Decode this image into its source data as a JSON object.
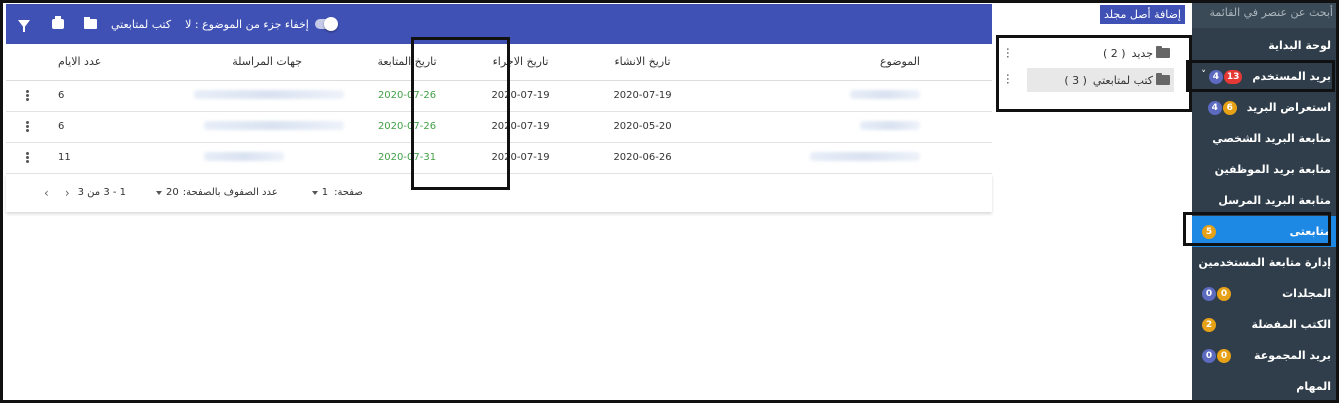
{
  "sidebar": {
    "search_placeholder": "أبحث عن عنصر في القائمة",
    "items": [
      {
        "label": "لوحة البداية",
        "badges": []
      },
      {
        "label": "بريد المستخدم",
        "badges": [
          {
            "value": "13",
            "color": "red"
          },
          {
            "value": "4",
            "color": "blue"
          }
        ],
        "caret": "˅"
      },
      {
        "label": "استعراض البريد",
        "badges": [
          {
            "value": "6",
            "color": "orange"
          },
          {
            "value": "4",
            "color": "blue"
          }
        ]
      },
      {
        "label": "متابعة البريد الشخصي",
        "badges": []
      },
      {
        "label": "متابعة بريد الموظفين",
        "badges": []
      },
      {
        "label": "متابعة البريد المرسل",
        "badges": []
      },
      {
        "label": "متابعتى",
        "badges": [
          {
            "value": "5",
            "color": "orange"
          }
        ],
        "active": true
      },
      {
        "label": "إدارة متابعة المستخدمين",
        "badges": []
      },
      {
        "label": "المجلدات",
        "badges": [
          {
            "value": "0",
            "color": "orange"
          },
          {
            "value": "0",
            "color": "blue"
          }
        ]
      },
      {
        "label": "الكتب المفضلة",
        "badges": [
          {
            "value": "2",
            "color": "orange"
          }
        ]
      },
      {
        "label": "بريد المجموعة",
        "badges": [
          {
            "value": "0",
            "color": "orange"
          },
          {
            "value": "0",
            "color": "blue"
          }
        ]
      },
      {
        "label": "المهام",
        "badges": []
      }
    ]
  },
  "folders": {
    "add_label": "إضافة أصل مجلد",
    "items": [
      {
        "name": "جديد",
        "count": "( 2 )"
      },
      {
        "name": "كتب لمتابعتي",
        "count": "( 3 )",
        "selected": true
      }
    ]
  },
  "toolbar": {
    "hide_subject_label": "إخفاء جزء من الموضوع : لا",
    "folder_label": "كتب لمتابعتي"
  },
  "table": {
    "headers": {
      "subject": "الموضوع",
      "created": "تاريخ الانشاء",
      "procedure": "تاريخ الاجراء",
      "followup": "تاريخ المتابعة",
      "correspondents": "جهات المراسلة",
      "days": "عدد الايام"
    },
    "rows": [
      {
        "subject": "",
        "created": "2020-07-19",
        "procedure": "2020-07-19",
        "followup": "2020-07-26",
        "correspondents": "",
        "days": "6"
      },
      {
        "subject": "",
        "created": "2020-05-20",
        "procedure": "2020-07-19",
        "followup": "2020-07-26",
        "correspondents": "",
        "days": "6"
      },
      {
        "subject": "",
        "created": "2020-06-26",
        "procedure": "2020-07-19",
        "followup": "2020-07-31",
        "correspondents": "",
        "days": "11"
      }
    ]
  },
  "pager": {
    "page_label": "صفحة:",
    "page_value": "1",
    "rows_label": "عدد الصفوف بالصفحة:",
    "rows_value": "20",
    "range": "1 - 3 من 3",
    "prev": "‹",
    "next": "›"
  },
  "colors": {
    "primary": "#3f51b5",
    "sidebar_bg": "#2f3e4a",
    "active": "#1e88e5",
    "followup_green": "#43a047"
  }
}
